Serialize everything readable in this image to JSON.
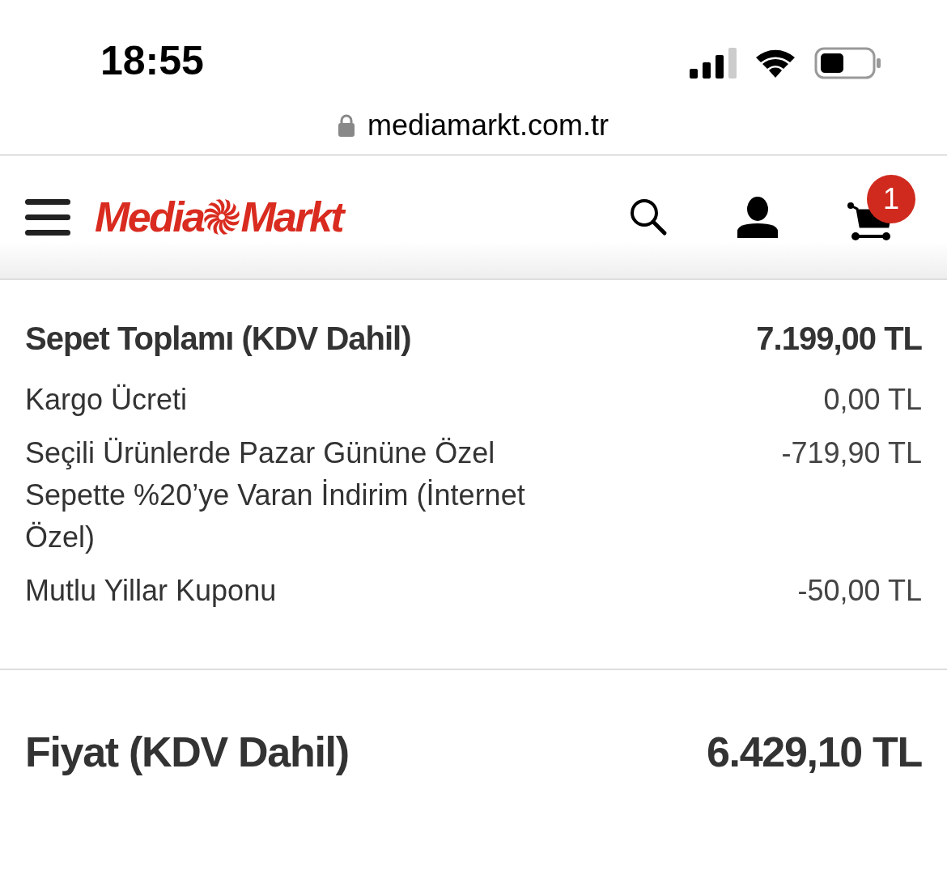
{
  "status_bar": {
    "time": "18:55",
    "url": "mediamarkt.com.tr"
  },
  "header": {
    "logo": {
      "left": "Media",
      "right": "Markt"
    },
    "cart_count": "1"
  },
  "summary": {
    "subtotal": {
      "label": "Sepet Toplamı (KDV Dahil)",
      "value": "7.199,00 TL"
    },
    "lines": [
      {
        "label": "Kargo Ücreti",
        "value": "0,00 TL"
      },
      {
        "label": "Seçili Ürünlerde Pazar Gününe Özel Sepette %20’ye Varan İndirim (İnternet Özel)",
        "value": "-719,90 TL"
      },
      {
        "label": "Mutlu Yillar Kuponu",
        "value": "-50,00 TL"
      }
    ]
  },
  "total": {
    "label": "Fiyat (KDV Dahil)",
    "value": "6.429,10 TL"
  }
}
